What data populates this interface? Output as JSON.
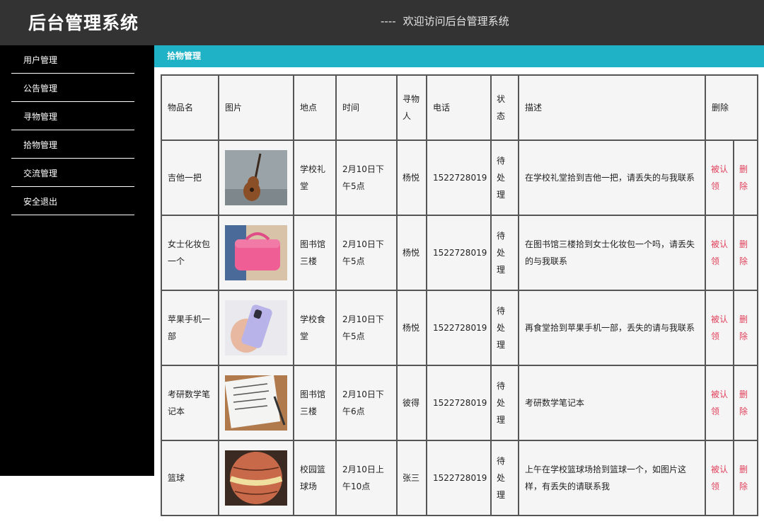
{
  "header": {
    "app_title": "后台管理系统",
    "welcome_dash": "----",
    "welcome_text": "欢迎访问后台管理系统"
  },
  "sidebar": {
    "items": [
      {
        "label": "用户管理"
      },
      {
        "label": "公告管理"
      },
      {
        "label": "寻物管理"
      },
      {
        "label": "拾物管理"
      },
      {
        "label": "交流管理"
      },
      {
        "label": "安全退出"
      }
    ]
  },
  "main": {
    "section_title": "拾物管理",
    "columns": {
      "name": "物品名",
      "image": "图片",
      "place": "地点",
      "time": "时间",
      "finder": "寻物人",
      "phone": "电话",
      "status": "状态",
      "desc": "描述",
      "delete": "删除"
    },
    "rows": [
      {
        "name": "吉他一把",
        "image_icon": "guitar-photo",
        "place": "学校礼堂",
        "time": "2月10日下午5点",
        "finder": "杨悦",
        "phone": "1522728019",
        "status": "待处理",
        "desc": "在学校礼堂拾到吉他一把，请丢失的与我联系",
        "claim": "被认领",
        "delete": "删除"
      },
      {
        "name": "女士化妆包一个",
        "image_icon": "cosmetic-bag-photo",
        "place": "图书馆三楼",
        "time": "2月10日下午5点",
        "finder": "杨悦",
        "phone": "1522728019",
        "status": "待处理",
        "desc": "在图书馆三楼拾到女士化妆包一个吗，请丢失的与我联系",
        "claim": "被认领",
        "delete": "删除"
      },
      {
        "name": "苹果手机一部",
        "image_icon": "phone-photo",
        "place": "学校食堂",
        "time": "2月10日下午5点",
        "finder": "杨悦",
        "phone": "1522728019",
        "status": "待处理",
        "desc": "再食堂拾到苹果手机一部，丢失的请与我联系",
        "claim": "被认领",
        "delete": "删除"
      },
      {
        "name": "考研数学笔记本",
        "image_icon": "notebook-photo",
        "place": "图书馆三楼",
        "time": "2月10日下午6点",
        "finder": "彼得",
        "phone": "1522728019",
        "status": "待处理",
        "desc": "考研数学笔记本",
        "claim": "被认领",
        "delete": "删除"
      },
      {
        "name": "篮球",
        "image_icon": "basketball-photo",
        "place": "校园篮球场",
        "time": "2月10日上午10点",
        "finder": "张三",
        "phone": "1522728019",
        "status": "待处理",
        "desc": "上午在学校篮球场拾到篮球一个，如图片这样，有丢失的请联系我",
        "claim": "被认领",
        "delete": "删除"
      }
    ]
  }
}
